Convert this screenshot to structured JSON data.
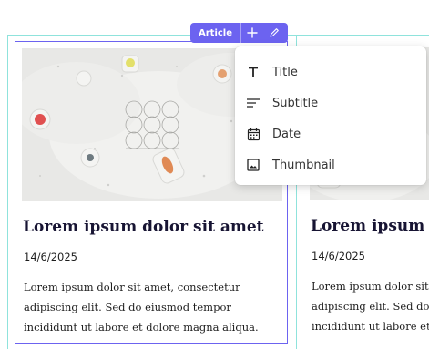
{
  "toolbar": {
    "label": "Article",
    "add_icon": "plus-icon",
    "edit_icon": "pencil-icon"
  },
  "dropdown": {
    "items": [
      {
        "label": "Title",
        "icon": "title-icon"
      },
      {
        "label": "Subtitle",
        "icon": "subtitle-icon"
      },
      {
        "label": "Date",
        "icon": "calendar-icon"
      },
      {
        "label": "Thumbnail",
        "icon": "image-icon"
      }
    ]
  },
  "cards": [
    {
      "title": "Lorem ipsum dolor sit amet",
      "date": "14/6/2025",
      "text_lines": [
        "Lorem ipsum dolor sit amet, consectetur",
        "adipiscing elit. Sed do eiusmod tempor",
        "incididunt ut labore et dolore magna aliqua."
      ]
    },
    {
      "title": "Lorem ipsum d",
      "date": "14/6/2025",
      "text_lines": [
        "Lorem ipsum dolor sit a",
        "adipiscing elit. Sed do e",
        "incididunt ut labore et d"
      ]
    }
  ],
  "colors": {
    "accent": "#6c63f0",
    "frame": "#8fe3dc",
    "title": "#171433"
  }
}
